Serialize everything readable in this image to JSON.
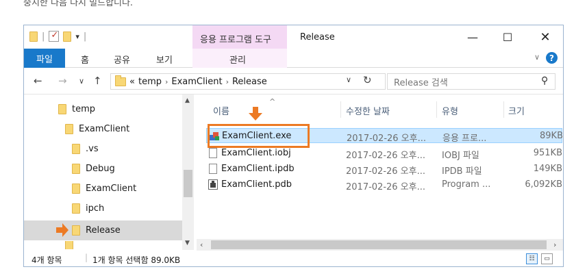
{
  "caption": "중지한 다음 다시 빌드합니다.",
  "window": {
    "title": "Release",
    "tool_tab": "응용 프로그램 도구",
    "tool_sub": "관리",
    "controls": {
      "minimize": "—",
      "maximize": "☐",
      "close": "✕"
    }
  },
  "ribbon": {
    "file": "파일",
    "tabs": [
      "홈",
      "공유",
      "보기"
    ],
    "help": "?"
  },
  "address": {
    "path": [
      "«",
      "temp",
      "ExamClient",
      "Release"
    ],
    "search_placeholder": "Release 검색"
  },
  "tree": [
    {
      "label": "temp",
      "level": 0
    },
    {
      "label": "ExamClient",
      "level": 1
    },
    {
      "label": ".vs",
      "level": 2
    },
    {
      "label": "Debug",
      "level": 2
    },
    {
      "label": "ExamClient",
      "level": 2
    },
    {
      "label": "ipch",
      "level": 2
    },
    {
      "label": "Release",
      "level": 2,
      "selected": true
    }
  ],
  "columns": {
    "name": "이름",
    "date": "수정한 날짜",
    "type": "유형",
    "size": "크기"
  },
  "files": [
    {
      "name": "ExamClient.exe",
      "date": "2017-02-26 오후...",
      "type": "응용 프로...",
      "size": "89KB",
      "icon": "exe-icon",
      "selected": true
    },
    {
      "name": "ExamClient.iobj",
      "date": "2017-02-26 오후...",
      "type": "IOBJ 파일",
      "size": "951KB",
      "icon": "document-icon"
    },
    {
      "name": "ExamClient.ipdb",
      "date": "2017-02-26 오후...",
      "type": "IPDB 파일",
      "size": "149KB",
      "icon": "document-icon"
    },
    {
      "name": "ExamClient.pdb",
      "date": "2017-02-26 오후...",
      "type": "Program ...",
      "size": "6,092KB",
      "icon": "pdb-icon"
    }
  ],
  "status": {
    "count": "4개 항목",
    "selection": "1개 항목 선택함 89.0KB"
  },
  "colors": {
    "accent": "#1979ca",
    "highlight": "#ec7a24",
    "selection": "#cce8ff"
  }
}
